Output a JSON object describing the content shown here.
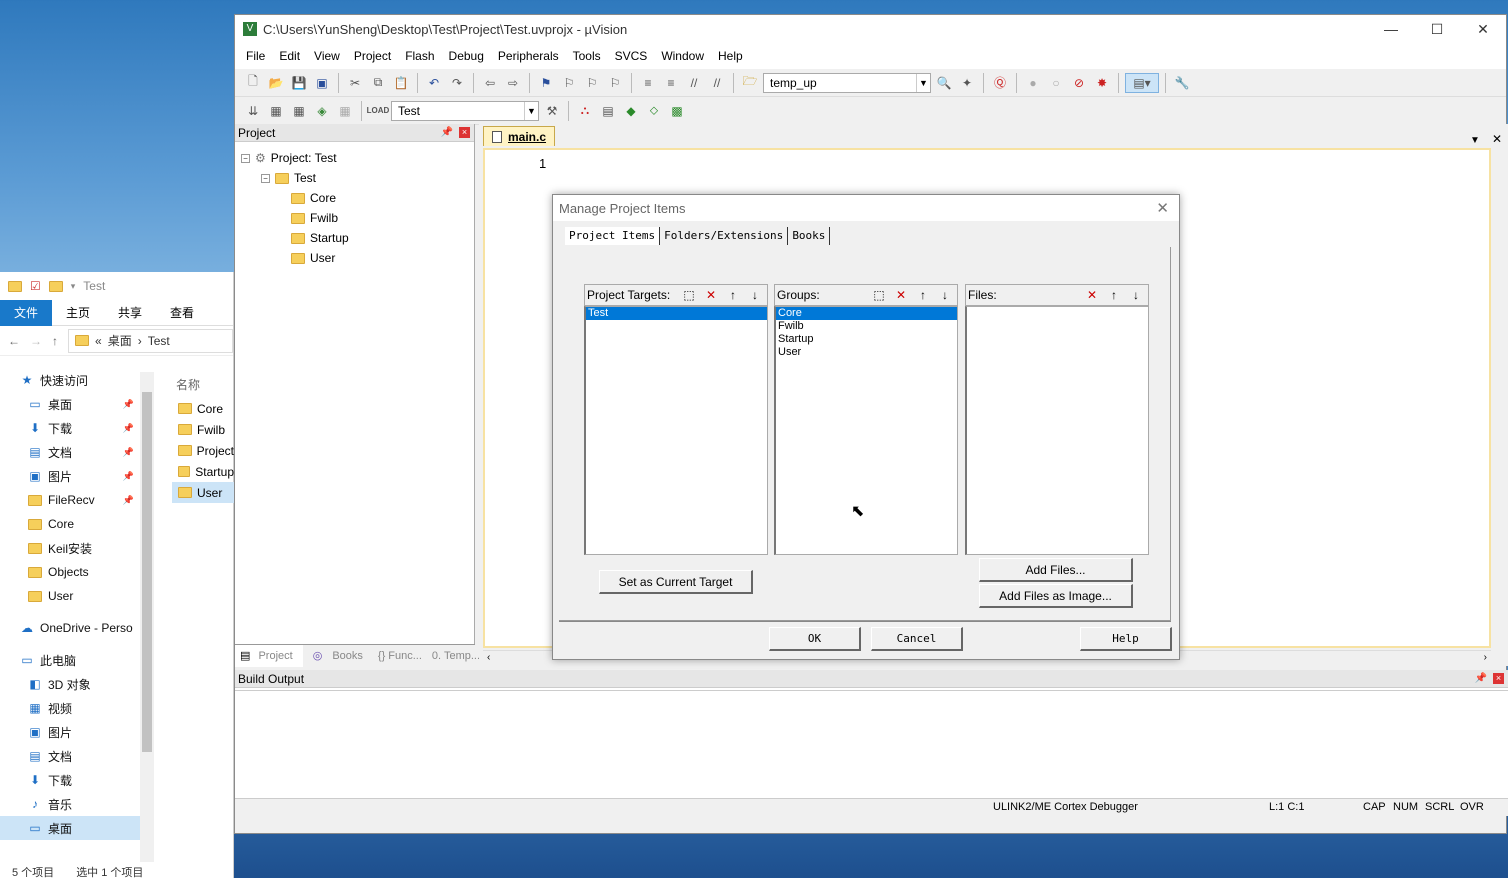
{
  "uv": {
    "title": "C:\\Users\\YunSheng\\Desktop\\Test\\Project\\Test.uvprojx - µVision",
    "menu": [
      "File",
      "Edit",
      "View",
      "Project",
      "Flash",
      "Debug",
      "Peripherals",
      "Tools",
      "SVCS",
      "Window",
      "Help"
    ],
    "combo1": "temp_up",
    "combo2": "Test",
    "project_header": "Project",
    "tree": {
      "root": "Project: Test",
      "target": "Test",
      "groups": [
        "Core",
        "Fwilb",
        "Startup",
        "User"
      ]
    },
    "bottom_tabs": [
      "Project",
      "Books",
      "{} Func...",
      "0. Temp..."
    ],
    "editor_tab": "main.c",
    "line_number": "1",
    "build_header": "Build Output",
    "status": {
      "debugger": "ULINK2/ME Cortex Debugger",
      "pos": "L:1 C:1",
      "cap": "CAP",
      "num": "NUM",
      "scrl": "SCRL",
      "ovr": "OVR"
    }
  },
  "dialog": {
    "title": "Manage Project Items",
    "tabs": [
      "Project Items",
      "Folders/Extensions",
      "Books"
    ],
    "targets_label": "Project Targets:",
    "targets": [
      "Test"
    ],
    "groups_label": "Groups:",
    "groups": [
      "Core",
      "Fwilb",
      "Startup",
      "User"
    ],
    "files_label": "Files:",
    "set_target": "Set as Current Target",
    "add_files": "Add Files...",
    "add_image": "Add Files as Image...",
    "ok": "OK",
    "cancel": "Cancel",
    "help": "Help"
  },
  "explorer": {
    "qa_title": "Test",
    "ribbon": [
      "文件",
      "主页",
      "共享",
      "查看"
    ],
    "path": [
      "桌面",
      "Test"
    ],
    "col_name": "名称",
    "nav": [
      {
        "label": "快速访问",
        "pin": false
      },
      {
        "label": "桌面",
        "pin": true
      },
      {
        "label": "下载",
        "pin": true
      },
      {
        "label": "文档",
        "pin": true
      },
      {
        "label": "图片",
        "pin": true
      },
      {
        "label": "FileRecv",
        "pin": true
      },
      {
        "label": "Core",
        "pin": false
      },
      {
        "label": "Keil安装",
        "pin": false
      },
      {
        "label": "Objects",
        "pin": false
      },
      {
        "label": "User",
        "pin": false
      },
      {
        "label": "OneDrive - Perso",
        "pin": false
      },
      {
        "label": "此电脑",
        "pin": false
      },
      {
        "label": "3D 对象",
        "pin": false
      },
      {
        "label": "视频",
        "pin": false
      },
      {
        "label": "图片",
        "pin": false
      },
      {
        "label": "文档",
        "pin": false
      },
      {
        "label": "下载",
        "pin": false
      },
      {
        "label": "音乐",
        "pin": false
      },
      {
        "label": "桌面",
        "pin": false
      }
    ],
    "files": [
      "Core",
      "Fwilb",
      "Project",
      "Startup",
      "User"
    ],
    "status_count": "5 个项目",
    "status_sel": "选中 1 个项目"
  }
}
